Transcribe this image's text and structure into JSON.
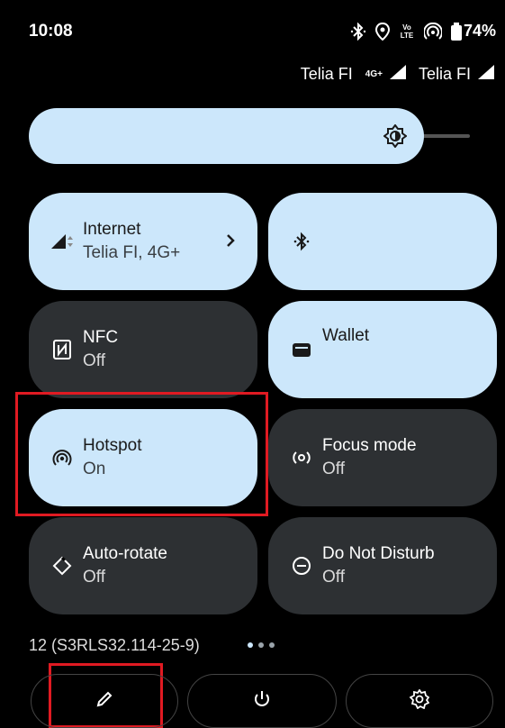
{
  "status_bar": {
    "time": "10:08",
    "volte_label": "Vo LTE",
    "battery": "74%"
  },
  "carriers": {
    "left": "Telia FI",
    "left_network": "4G+",
    "right": "Telia FI"
  },
  "brightness": {
    "level": 0.85
  },
  "tiles": [
    {
      "title": "Internet",
      "subtitle": "Telia FI, 4G+",
      "state": "on",
      "icon": "signal-icon"
    },
    {
      "title": "",
      "subtitle": "",
      "state": "on",
      "icon": "bluetooth-icon"
    },
    {
      "title": "NFC",
      "subtitle": "Off",
      "state": "off",
      "icon": "nfc-icon"
    },
    {
      "title": "Wallet",
      "subtitle": "",
      "state": "on",
      "icon": "wallet-icon"
    },
    {
      "title": "Hotspot",
      "subtitle": "On",
      "state": "on",
      "icon": "hotspot-icon"
    },
    {
      "title": "Focus mode",
      "subtitle": "Off",
      "state": "off",
      "icon": "focus-icon"
    },
    {
      "title": "Auto-rotate",
      "subtitle": "Off",
      "state": "off",
      "icon": "rotate-icon"
    },
    {
      "title": "Do Not Disturb",
      "subtitle": "Off",
      "state": "off",
      "icon": "dnd-icon"
    }
  ],
  "build_number": "12 (S3RLS32.114-25-9)",
  "page_dots": 3,
  "bottom_buttons": [
    "edit-icon",
    "power-icon",
    "settings-icon"
  ],
  "colors": {
    "tile_on": "#cce7fb",
    "tile_off": "#2d3033",
    "highlight": "#e01a22"
  }
}
